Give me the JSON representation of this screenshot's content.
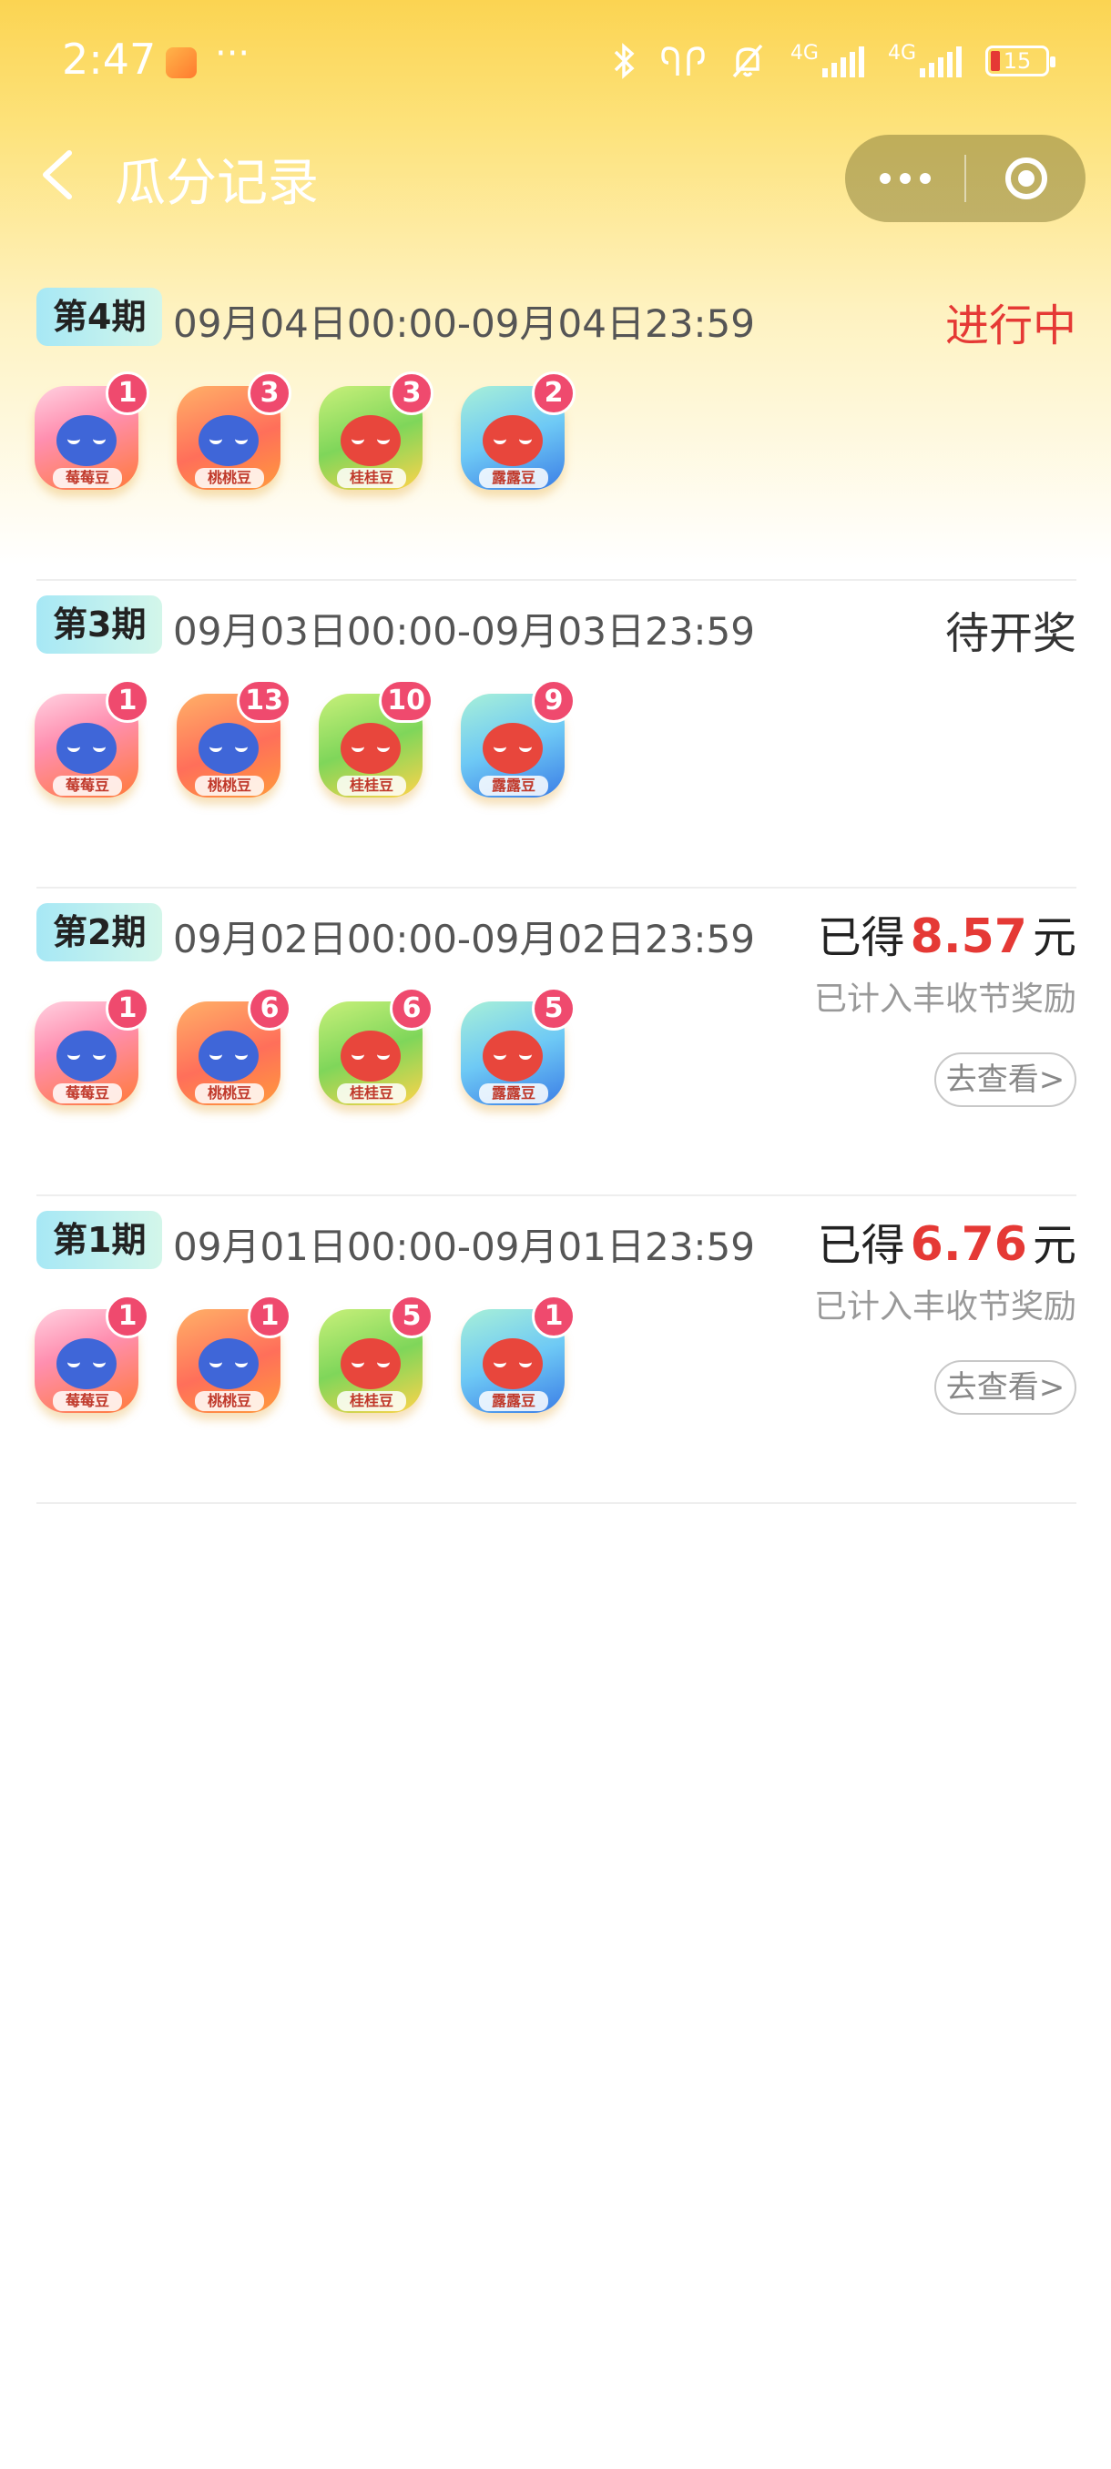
{
  "status_bar": {
    "time": "2:47",
    "dots": "···",
    "net1": "4G",
    "net2": "4G",
    "battery": "15"
  },
  "nav": {
    "title": "瓜分记录"
  },
  "periods": [
    {
      "badge": "第4期",
      "range": "09月04日00:00-09月04日23:59",
      "status": "进行中",
      "beans": [
        {
          "type": "strawberry",
          "tag": "莓莓豆",
          "count": "1"
        },
        {
          "type": "peach",
          "tag": "桃桃豆",
          "count": "3"
        },
        {
          "type": "flower",
          "tag": "桂桂豆",
          "count": "3"
        },
        {
          "type": "leaf",
          "tag": "露露豆",
          "count": "2"
        }
      ]
    },
    {
      "badge": "第3期",
      "range": "09月03日00:00-09月03日23:59",
      "status": "待开奖",
      "beans": [
        {
          "type": "strawberry",
          "tag": "莓莓豆",
          "count": "1"
        },
        {
          "type": "peach",
          "tag": "桃桃豆",
          "count": "13"
        },
        {
          "type": "flower",
          "tag": "桂桂豆",
          "count": "10"
        },
        {
          "type": "leaf",
          "tag": "露露豆",
          "count": "9"
        }
      ]
    },
    {
      "badge": "第2期",
      "range": "09月02日00:00-09月02日23:59",
      "earn_prefix": "已得",
      "amount": "8.57",
      "earn_suffix": "元",
      "note": "已计入丰收节奖励",
      "button": "去查看>",
      "beans": [
        {
          "type": "strawberry",
          "tag": "莓莓豆",
          "count": "1"
        },
        {
          "type": "peach",
          "tag": "桃桃豆",
          "count": "6"
        },
        {
          "type": "flower",
          "tag": "桂桂豆",
          "count": "6"
        },
        {
          "type": "leaf",
          "tag": "露露豆",
          "count": "5"
        }
      ]
    },
    {
      "badge": "第1期",
      "range": "09月01日00:00-09月01日23:59",
      "earn_prefix": "已得",
      "amount": "6.76",
      "earn_suffix": "元",
      "note": "已计入丰收节奖励",
      "button": "去查看>",
      "beans": [
        {
          "type": "strawberry",
          "tag": "莓莓豆",
          "count": "1"
        },
        {
          "type": "peach",
          "tag": "桃桃豆",
          "count": "1"
        },
        {
          "type": "flower",
          "tag": "桂桂豆",
          "count": "5"
        },
        {
          "type": "leaf",
          "tag": "露露豆",
          "count": "1"
        }
      ]
    }
  ]
}
